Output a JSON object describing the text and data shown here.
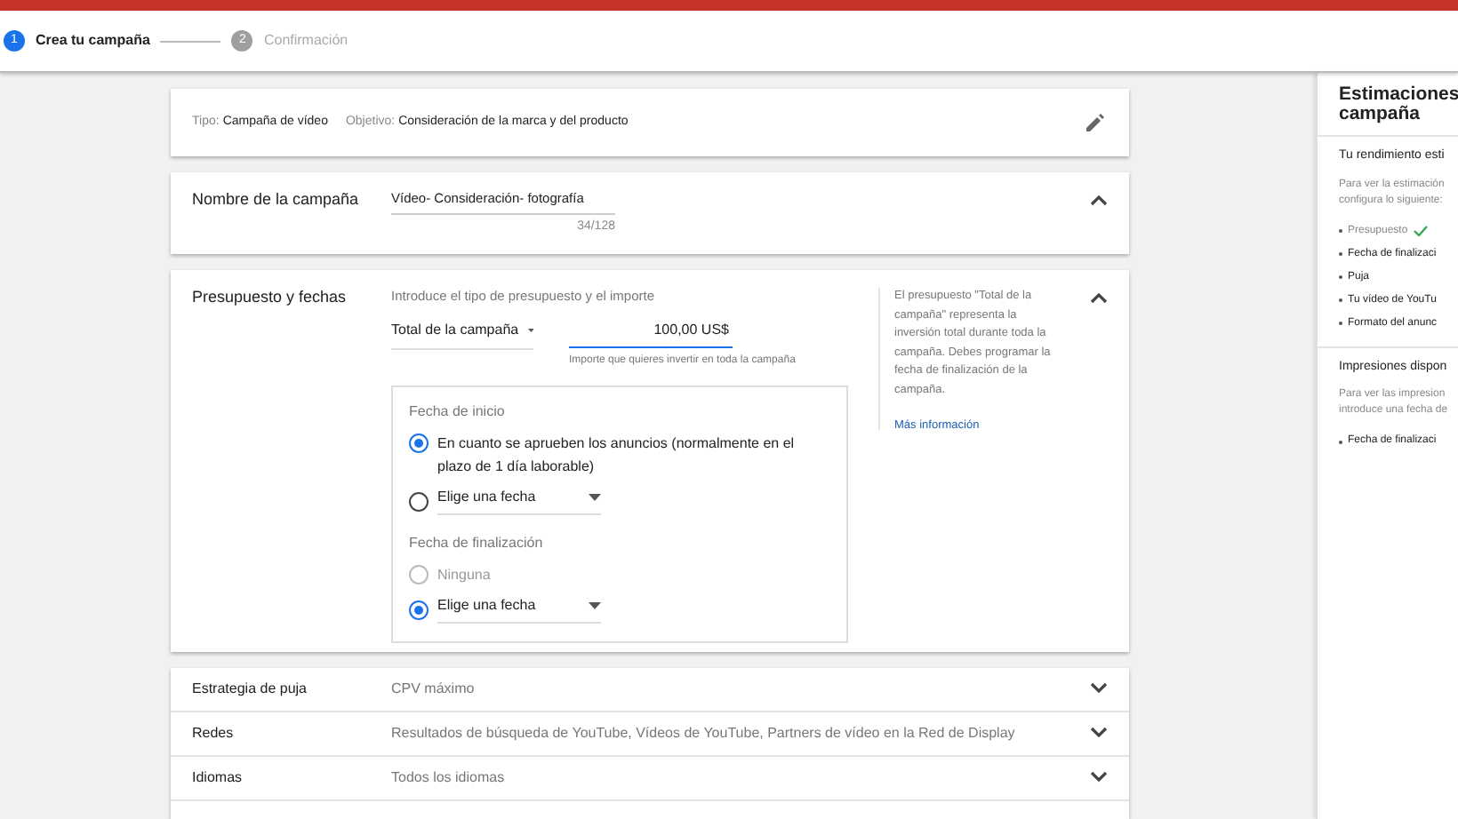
{
  "stepper": [
    {
      "number": "1",
      "label": "Crea tu campaña",
      "selected": true
    },
    {
      "number": "2",
      "label": "Confirmación",
      "selected": false
    }
  ],
  "summary": {
    "type_label": "Tipo:",
    "type_value": "Campaña de vídeo",
    "goal_label": "Objetivo:",
    "goal_value": "Consideración de la marca y del producto"
  },
  "name_section": {
    "title": "Nombre de la campaña",
    "value": "Vídeo- Consideración- fotografía",
    "counter": "34/128",
    "expanded": true
  },
  "budget_section": {
    "title": "Presupuesto y fechas",
    "expanded": true,
    "intro": "Introduce el tipo de presupuesto y el importe",
    "budget_type": "Total de la campaña",
    "amount": "100,00 US$",
    "amount_hint": "Importe que quieres invertir en toda la campaña",
    "start_label": "Fecha de inicio",
    "start_options": [
      {
        "label": "En cuanto se aprueben los anuncios (normalmente en el plazo de 1 día laborable)",
        "kind": "plain",
        "selected": true,
        "disabled": false
      },
      {
        "label": "Elige una fecha",
        "kind": "dropdown",
        "selected": false,
        "disabled": false
      }
    ],
    "end_label": "Fecha de finalización",
    "end_options": [
      {
        "label": "Ninguna",
        "kind": "plain",
        "selected": false,
        "disabled": true
      },
      {
        "label": "Elige una fecha",
        "kind": "dropdown",
        "selected": true,
        "disabled": false
      }
    ],
    "help_text": "El presupuesto \"Total de la campaña\" representa la inversión total durante toda la campaña. Debes programar la fecha de finalización de la campaña.",
    "help_link": "Más información"
  },
  "collapsed_sections": [
    {
      "title": "Estrategia de puja",
      "value": "CPV máximo",
      "expanded": false
    },
    {
      "title": "Redes",
      "value": "Resultados de búsqueda de YouTube, Vídeos de YouTube, Partners de vídeo en la Red de Display",
      "expanded": false
    },
    {
      "title": "Idiomas",
      "value": "Todos los idiomas",
      "expanded": false
    }
  ],
  "estimates": {
    "title_line1": "Estimaciones",
    "title_line2": "campaña",
    "performance_title": "Tu rendimiento esti",
    "performance_text": [
      "Para ver la estimación",
      "configura lo siguiente:"
    ],
    "requirements": [
      {
        "label": "Presupuesto",
        "checked": true
      },
      {
        "label": "Fecha de finalizaci",
        "checked": false
      },
      {
        "label": "Puja",
        "checked": false
      },
      {
        "label": "Tu vídeo de YouTu",
        "checked": false
      },
      {
        "label": "Formato del anunc",
        "checked": false
      }
    ],
    "impressions_title": "Impresiones dispon",
    "impressions_text": [
      "Para ver las impresion",
      "introduce una fecha de"
    ],
    "impressions_requirements": [
      {
        "label": "Fecha de finalizaci",
        "checked": false
      }
    ]
  }
}
